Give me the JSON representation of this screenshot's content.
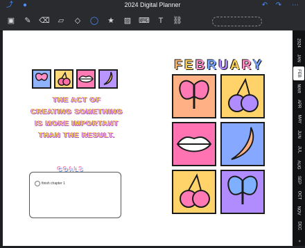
{
  "app": {
    "title": "2024 Digital Planner"
  },
  "left_page": {
    "quote_lines": [
      "THE ACT OF",
      "CREATING SOMETHING",
      "IS MORE IMPORTANT",
      "THAN THE RESULT."
    ],
    "goals_label": "GOALS",
    "goals": [
      {
        "text": "finish chapter 1",
        "checked": false
      }
    ],
    "small_tiles": [
      {
        "icon": "butterfly-icon",
        "color": "#8fb3ff"
      },
      {
        "icon": "cherries-icon",
        "color": "#ffd87a"
      },
      {
        "icon": "lips-icon",
        "color": "#ff7bb5"
      },
      {
        "icon": "banana-icon",
        "color": "#b996ff"
      }
    ]
  },
  "right_page": {
    "month": "FEBRUARY",
    "month_letter_colors": [
      "#ffb86b",
      "#ffd15a",
      "#ff8ec7",
      "#78a6ff",
      "#b488ff",
      "#ffd15a",
      "#ff8ec7",
      "#78a6ff"
    ],
    "tiles": [
      {
        "icon": "butterfly-icon",
        "color": "#ffb085"
      },
      {
        "icon": "cherries-icon",
        "color": "#ffd36a"
      },
      {
        "icon": "lips-icon",
        "color": "#ff73b3"
      },
      {
        "icon": "banana-icon",
        "color": "#86a8ff"
      },
      {
        "icon": "cherries-icon",
        "color": "#ffd36a"
      },
      {
        "icon": "butterfly-icon",
        "color": "#b08cff"
      }
    ]
  },
  "tabs": [
    "2024",
    "JAN",
    "FEB",
    "MAR",
    "APR",
    "MAY",
    "JUN",
    "JUL",
    "AUG",
    "SEP",
    "OCT",
    "NOV",
    "DEC",
    "+"
  ],
  "active_tab": "FEB"
}
